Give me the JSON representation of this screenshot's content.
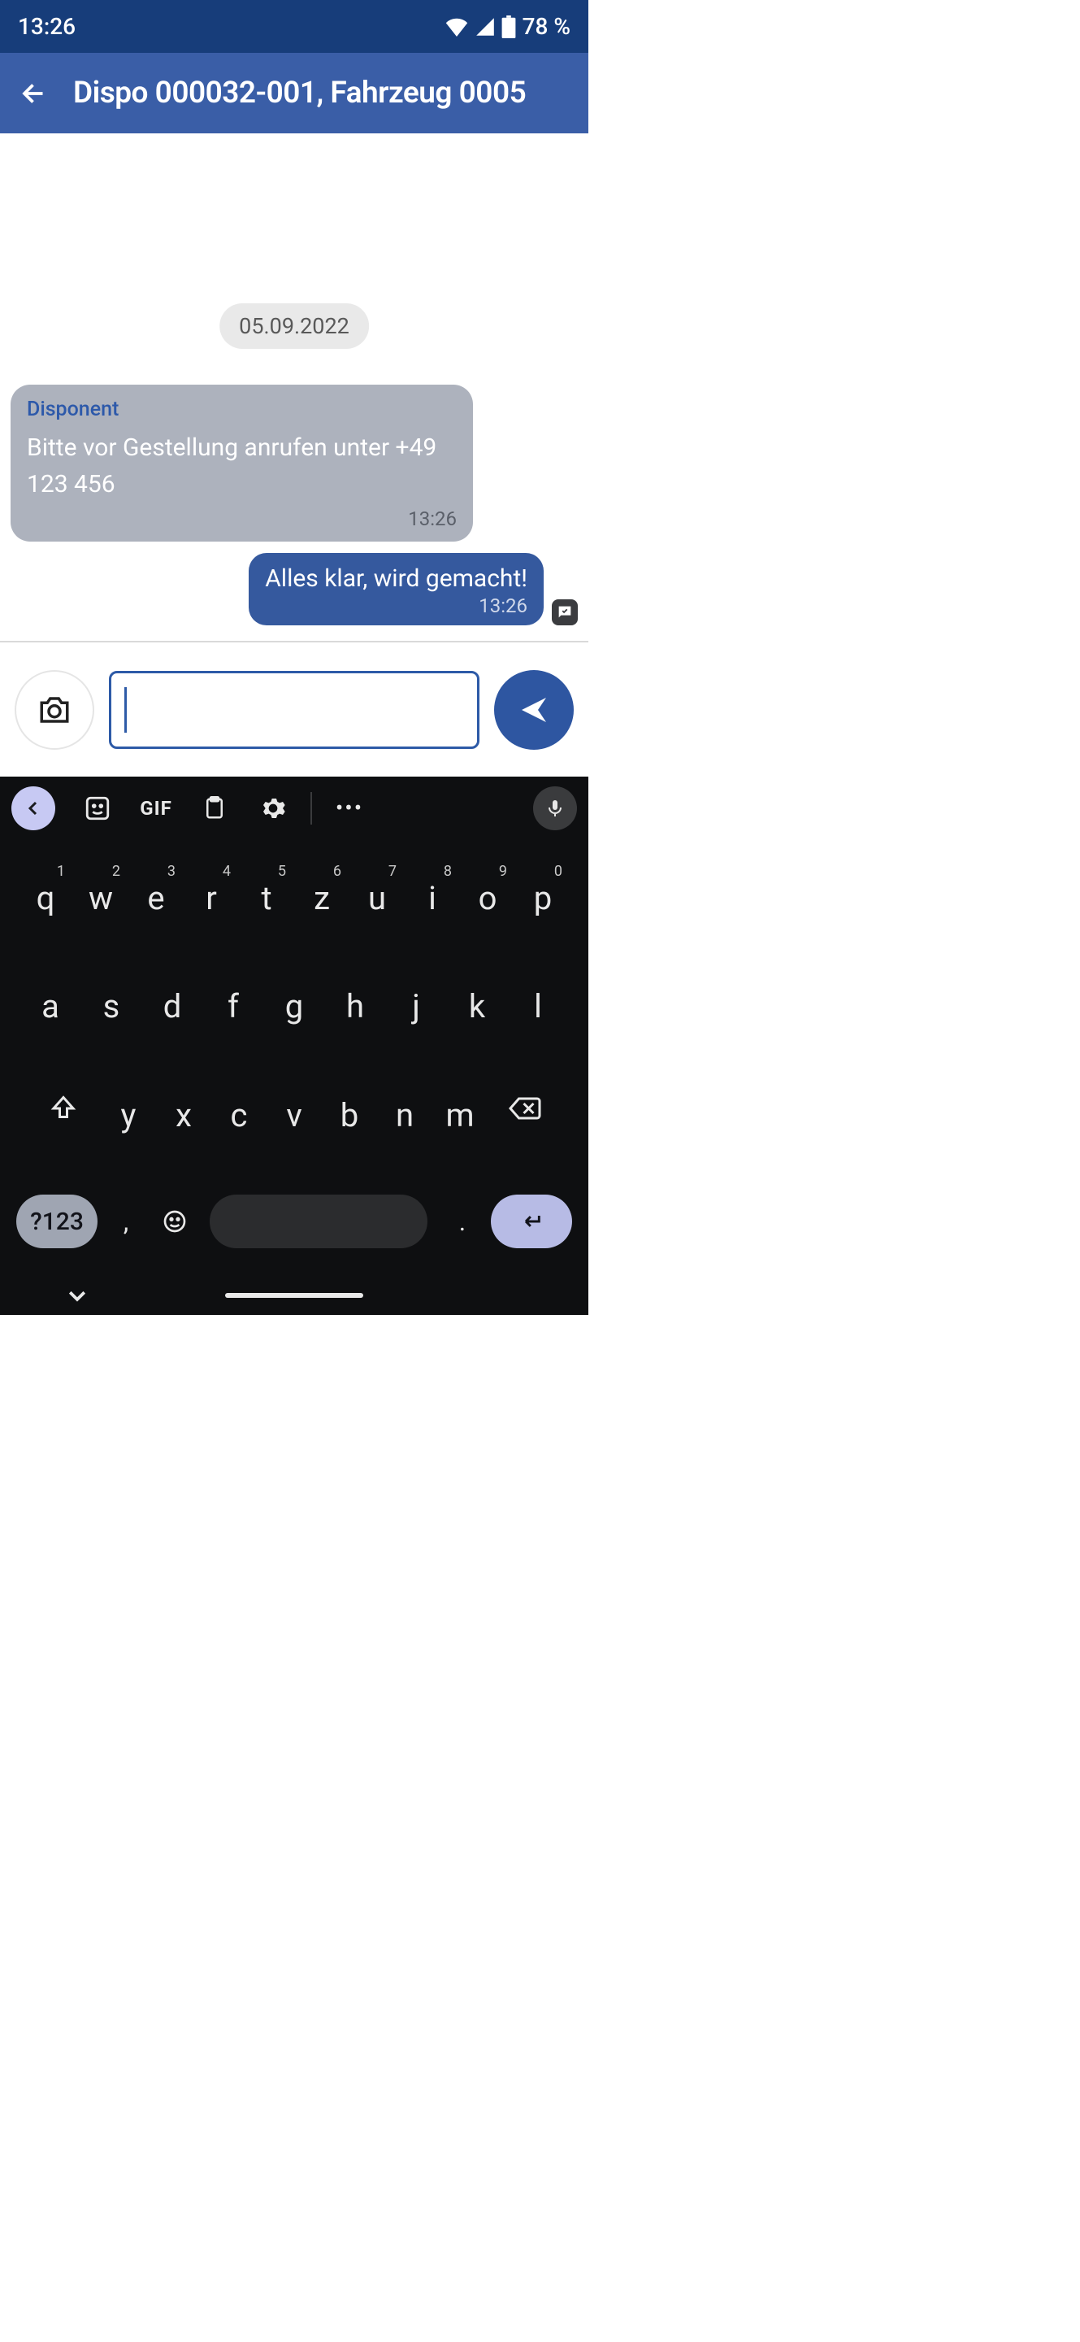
{
  "statusbar": {
    "time": "13:26",
    "battery": "78 %"
  },
  "appbar": {
    "title": "Dispo 000032-001, Fahrzeug 0005"
  },
  "chat": {
    "date": "05.09.2022",
    "incoming": {
      "sender": "Disponent",
      "text": "Bitte vor Gestellung anrufen unter +49 123 456",
      "time": "13:26"
    },
    "outgoing": {
      "text": "Alles klar, wird gemacht!",
      "time": "13:26"
    }
  },
  "input": {
    "value": "",
    "placeholder": ""
  },
  "keyboard": {
    "gif": "GIF",
    "row1": [
      {
        "k": "q",
        "n": "1"
      },
      {
        "k": "w",
        "n": "2"
      },
      {
        "k": "e",
        "n": "3"
      },
      {
        "k": "r",
        "n": "4"
      },
      {
        "k": "t",
        "n": "5"
      },
      {
        "k": "z",
        "n": "6"
      },
      {
        "k": "u",
        "n": "7"
      },
      {
        "k": "i",
        "n": "8"
      },
      {
        "k": "o",
        "n": "9"
      },
      {
        "k": "p",
        "n": "0"
      }
    ],
    "row2": [
      "a",
      "s",
      "d",
      "f",
      "g",
      "h",
      "j",
      "k",
      "l"
    ],
    "row3": [
      "y",
      "x",
      "c",
      "v",
      "b",
      "n",
      "m"
    ],
    "numsym": "?123",
    "comma": ",",
    "dot": "."
  }
}
